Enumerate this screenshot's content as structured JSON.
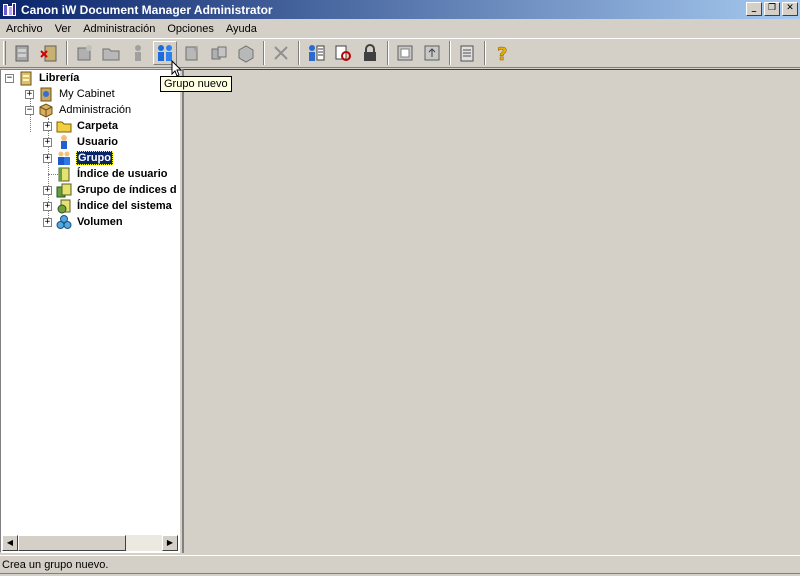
{
  "window": {
    "title": "Canon iW Document Manager Administrator"
  },
  "menu": [
    "Archivo",
    "Ver",
    "Administración",
    "Opciones",
    "Ayuda"
  ],
  "tooltip": "Grupo nuevo",
  "tree": {
    "root": "Librería",
    "items": [
      {
        "label": "My Cabinet"
      },
      {
        "label": "Administración"
      },
      {
        "label": "Carpeta"
      },
      {
        "label": "Usuario"
      },
      {
        "label": "Grupo"
      },
      {
        "label": "Índice de usuario"
      },
      {
        "label": "Grupo de índices d"
      },
      {
        "label": "Índice del sistema"
      },
      {
        "label": "Volumen"
      }
    ]
  },
  "status": {
    "text": "Crea un grupo nuevo."
  },
  "colors": {
    "titlebar_start": "#0a246a",
    "titlebar_end": "#a6caf0",
    "face": "#d4d0c8",
    "selection": "#0a246a",
    "tooltip_bg": "#ffffe1"
  }
}
